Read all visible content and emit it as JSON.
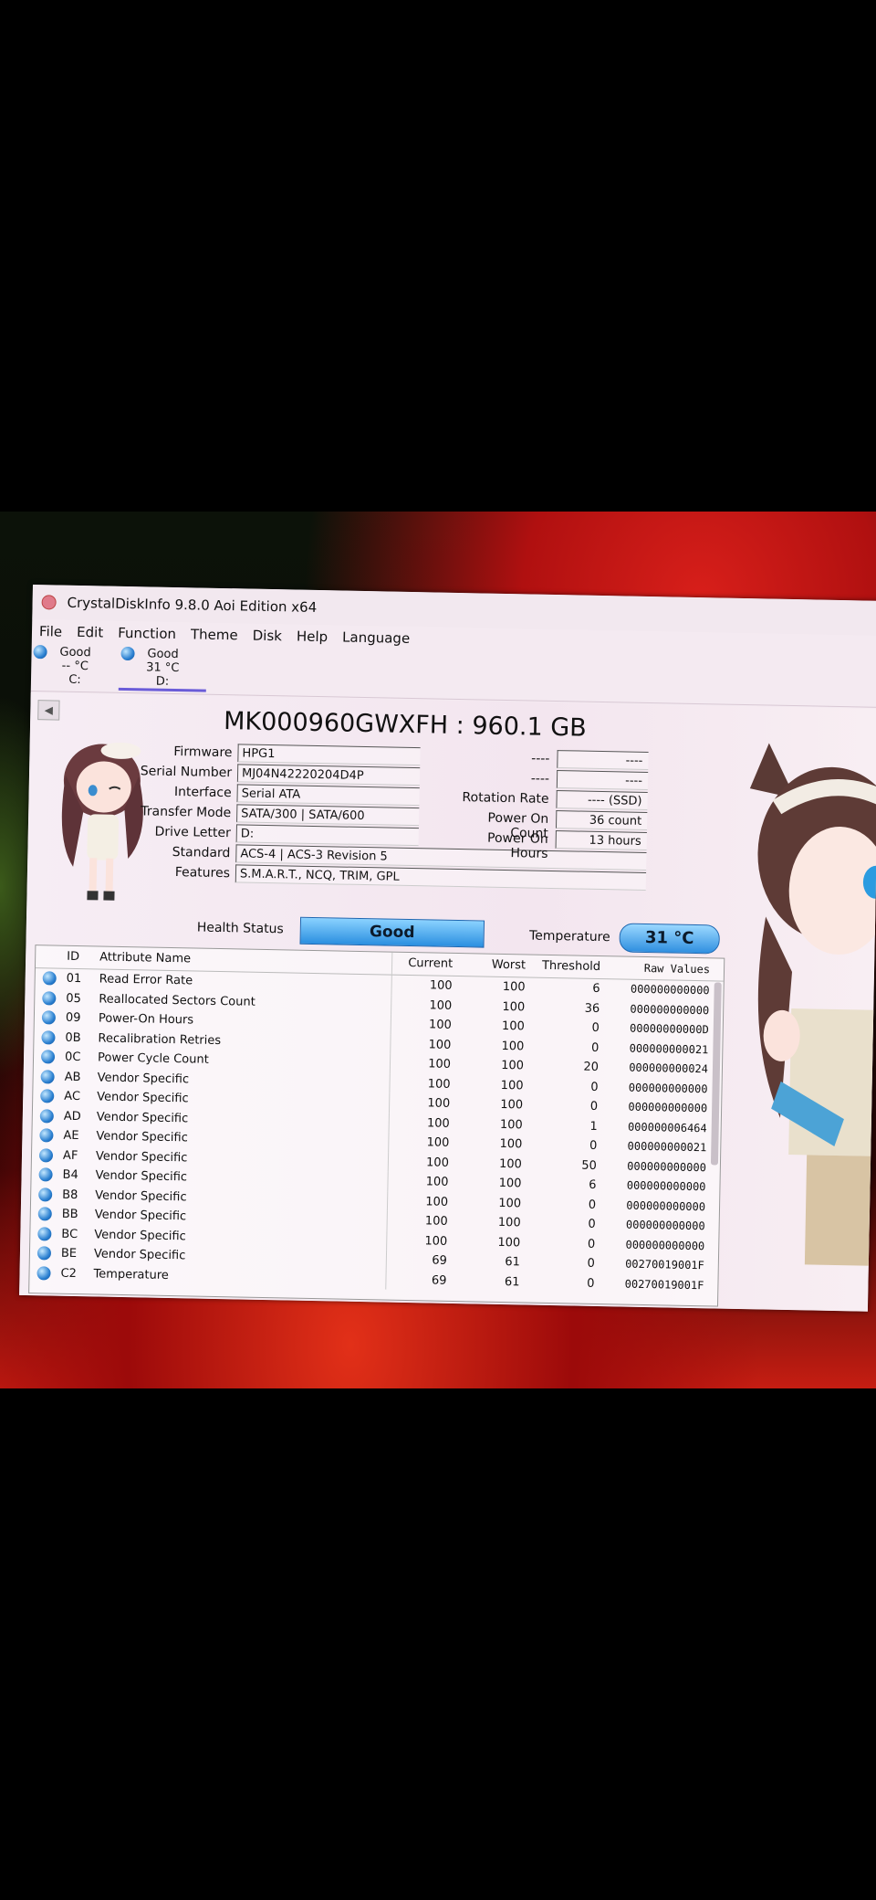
{
  "window": {
    "title": "CrystalDiskInfo 9.8.0 Aoi Edition x64"
  },
  "menu": [
    "File",
    "Edit",
    "Function",
    "Theme",
    "Disk",
    "Help",
    "Language"
  ],
  "disks": [
    {
      "status": "Good",
      "temp": "-- °C",
      "letter": "C:"
    },
    {
      "status": "Good",
      "temp": "31 °C",
      "letter": "D:"
    }
  ],
  "drive": {
    "model": "MK000960GWXFH : 960.1 GB",
    "firmware_label": "Firmware",
    "firmware": "HPG1",
    "serial_label": "Serial Number",
    "serial": "MJ04N42220204D4P",
    "interface_label": "Interface",
    "interface": "Serial ATA",
    "transfer_label": "Transfer Mode",
    "transfer": "SATA/300 | SATA/600",
    "letter_label": "Drive Letter",
    "letter": "D:",
    "standard_label": "Standard",
    "standard": "ACS-4 | ACS-3 Revision 5",
    "features_label": "Features",
    "features": "S.M.A.R.T., NCQ, TRIM, GPL",
    "health_label": "Health Status",
    "health": "Good",
    "temp_label": "Temperature",
    "temp": "31 °C",
    "blank_label1": "----",
    "blank_val1": "----",
    "blank_label2": "----",
    "blank_val2": "----",
    "rotation_label": "Rotation Rate",
    "rotation": "---- (SSD)",
    "poweron_count_label": "Power On Count",
    "poweron_count": "36 count",
    "poweron_hours_label": "Power On Hours",
    "poweron_hours": "13 hours"
  },
  "table": {
    "headers": {
      "id": "ID",
      "name": "Attribute Name",
      "current": "Current",
      "worst": "Worst",
      "threshold": "Threshold",
      "raw": "Raw Values"
    },
    "rows": [
      {
        "id": "01",
        "name": "Read Error Rate",
        "current": "100",
        "worst": "100",
        "threshold": "6",
        "raw": "000000000000"
      },
      {
        "id": "05",
        "name": "Reallocated Sectors Count",
        "current": "100",
        "worst": "100",
        "threshold": "36",
        "raw": "000000000000"
      },
      {
        "id": "09",
        "name": "Power-On Hours",
        "current": "100",
        "worst": "100",
        "threshold": "0",
        "raw": "00000000000D"
      },
      {
        "id": "0B",
        "name": "Recalibration Retries",
        "current": "100",
        "worst": "100",
        "threshold": "0",
        "raw": "000000000021"
      },
      {
        "id": "0C",
        "name": "Power Cycle Count",
        "current": "100",
        "worst": "100",
        "threshold": "20",
        "raw": "000000000024"
      },
      {
        "id": "AB",
        "name": "Vendor Specific",
        "current": "100",
        "worst": "100",
        "threshold": "0",
        "raw": "000000000000"
      },
      {
        "id": "AC",
        "name": "Vendor Specific",
        "current": "100",
        "worst": "100",
        "threshold": "0",
        "raw": "000000000000"
      },
      {
        "id": "AD",
        "name": "Vendor Specific",
        "current": "100",
        "worst": "100",
        "threshold": "1",
        "raw": "000000006464"
      },
      {
        "id": "AE",
        "name": "Vendor Specific",
        "current": "100",
        "worst": "100",
        "threshold": "0",
        "raw": "000000000021"
      },
      {
        "id": "AF",
        "name": "Vendor Specific",
        "current": "100",
        "worst": "100",
        "threshold": "50",
        "raw": "000000000000"
      },
      {
        "id": "B4",
        "name": "Vendor Specific",
        "current": "100",
        "worst": "100",
        "threshold": "6",
        "raw": "000000000000"
      },
      {
        "id": "B8",
        "name": "Vendor Specific",
        "current": "100",
        "worst": "100",
        "threshold": "0",
        "raw": "000000000000"
      },
      {
        "id": "BB",
        "name": "Vendor Specific",
        "current": "100",
        "worst": "100",
        "threshold": "0",
        "raw": "000000000000"
      },
      {
        "id": "BC",
        "name": "Vendor Specific",
        "current": "100",
        "worst": "100",
        "threshold": "0",
        "raw": "000000000000"
      },
      {
        "id": "BE",
        "name": "Vendor Specific",
        "current": "69",
        "worst": "61",
        "threshold": "0",
        "raw": "00270019001F"
      },
      {
        "id": "C2",
        "name": "Temperature",
        "current": "69",
        "worst": "61",
        "threshold": "0",
        "raw": "00270019001F"
      }
    ]
  }
}
